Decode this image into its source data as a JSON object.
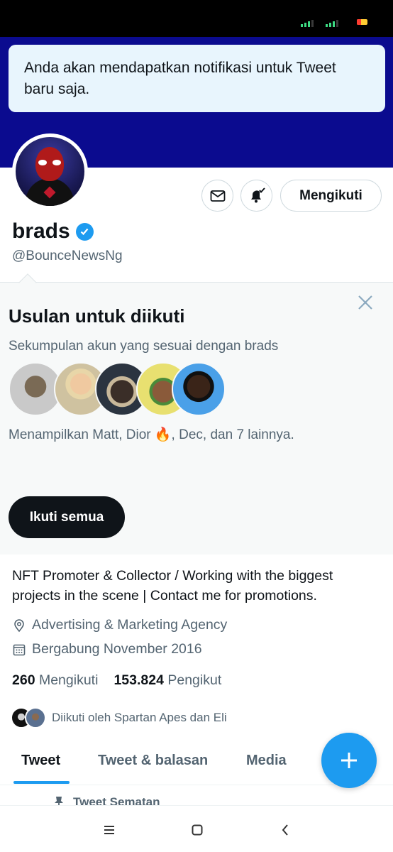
{
  "toast": {
    "message": "Anda akan mendapatkan notifikasi untuk Tweet baru saja."
  },
  "profile": {
    "name": "brads",
    "handle": "@BounceNewsNg",
    "follow_button": "Mengikuti",
    "bio": "NFT Promoter & Collector / Working with the biggest projects in the scene | Contact me for promotions.",
    "category": "Advertising & Marketing Agency",
    "joined": "Bergabung November 2016",
    "following_count": "260",
    "following_label": "Mengikuti",
    "followers_count": "153.824",
    "followers_label": "Pengikut",
    "followed_by": "Diikuti oleh Spartan Apes dan Eli"
  },
  "suggestions": {
    "title": "Usulan untuk diikuti",
    "subtitle": "Sekumpulan akun yang sesuai dengan brads",
    "description": "Menampilkan Matt, Dior 🔥, Dec, dan 7 lainnya.",
    "follow_all": "Ikuti semua"
  },
  "tabs": [
    {
      "label": "Tweet"
    },
    {
      "label": "Tweet & balasan"
    },
    {
      "label": "Media"
    }
  ],
  "pinned": {
    "label": "Tweet Sematan"
  },
  "colors": {
    "accent": "#1d9bf0",
    "banner": "#0b0b8f",
    "text": "#0f1419",
    "muted": "#536471"
  }
}
